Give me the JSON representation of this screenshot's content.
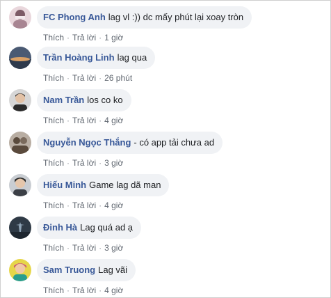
{
  "comments": [
    {
      "author": "FC Phong Anh",
      "text": "lag vl :)) dc mấy phút lại xoay tròn",
      "like": "Thích",
      "reply": "Trả lời",
      "time": "1 giờ",
      "avatar": {
        "icon": "avatar-photo-icon",
        "bg": "#e9d7dc",
        "fg": "#7d5b66"
      }
    },
    {
      "author": "Trần Hoàng Linh",
      "text": "lag qua",
      "like": "Thích",
      "reply": "Trả lời",
      "time": "26 phút",
      "avatar": {
        "icon": "avatar-sunset-icon",
        "bg": "#4a5a73",
        "fg": "#d9a066"
      }
    },
    {
      "author": "Nam Trần",
      "text": "los co ko",
      "like": "Thích",
      "reply": "Trả lời",
      "time": "4 giờ",
      "avatar": {
        "icon": "avatar-person-icon",
        "bg": "#d6d6d6",
        "fg": "#2b2b2b"
      }
    },
    {
      "author": "Nguyễn Ngọc Thắng",
      "text": "- có app tải chưa ad",
      "like": "Thích",
      "reply": "Trả lời",
      "time": "3 giờ",
      "avatar": {
        "icon": "avatar-group-icon",
        "bg": "#b9aea3",
        "fg": "#5a4a3c"
      }
    },
    {
      "author": "Hiếu Minh",
      "text": "Game lag dã man",
      "like": "Thích",
      "reply": "Trả lời",
      "time": "4 giờ",
      "avatar": {
        "icon": "avatar-person-icon",
        "bg": "#c9cdd2",
        "fg": "#2a2a2a"
      }
    },
    {
      "author": "Đinh Hà",
      "text": "Lag quá ad ạ",
      "like": "Thích",
      "reply": "Trả lời",
      "time": "3 giờ",
      "avatar": {
        "icon": "avatar-silhouette-icon",
        "bg": "#2f3a46",
        "fg": "#8fa3b5"
      }
    },
    {
      "author": "Sam Truong",
      "text": "Lag vãi",
      "like": "Thích",
      "reply": "Trả lời",
      "time": "4 giờ",
      "avatar": {
        "icon": "avatar-colorful-icon",
        "bg": "#e6d64a",
        "fg": "#c8428a"
      }
    }
  ],
  "colors": {
    "author": "#385898",
    "text": "#1c1e21",
    "meta": "#606770",
    "bubble": "#f0f2f5",
    "border": "#cfcfcf"
  }
}
